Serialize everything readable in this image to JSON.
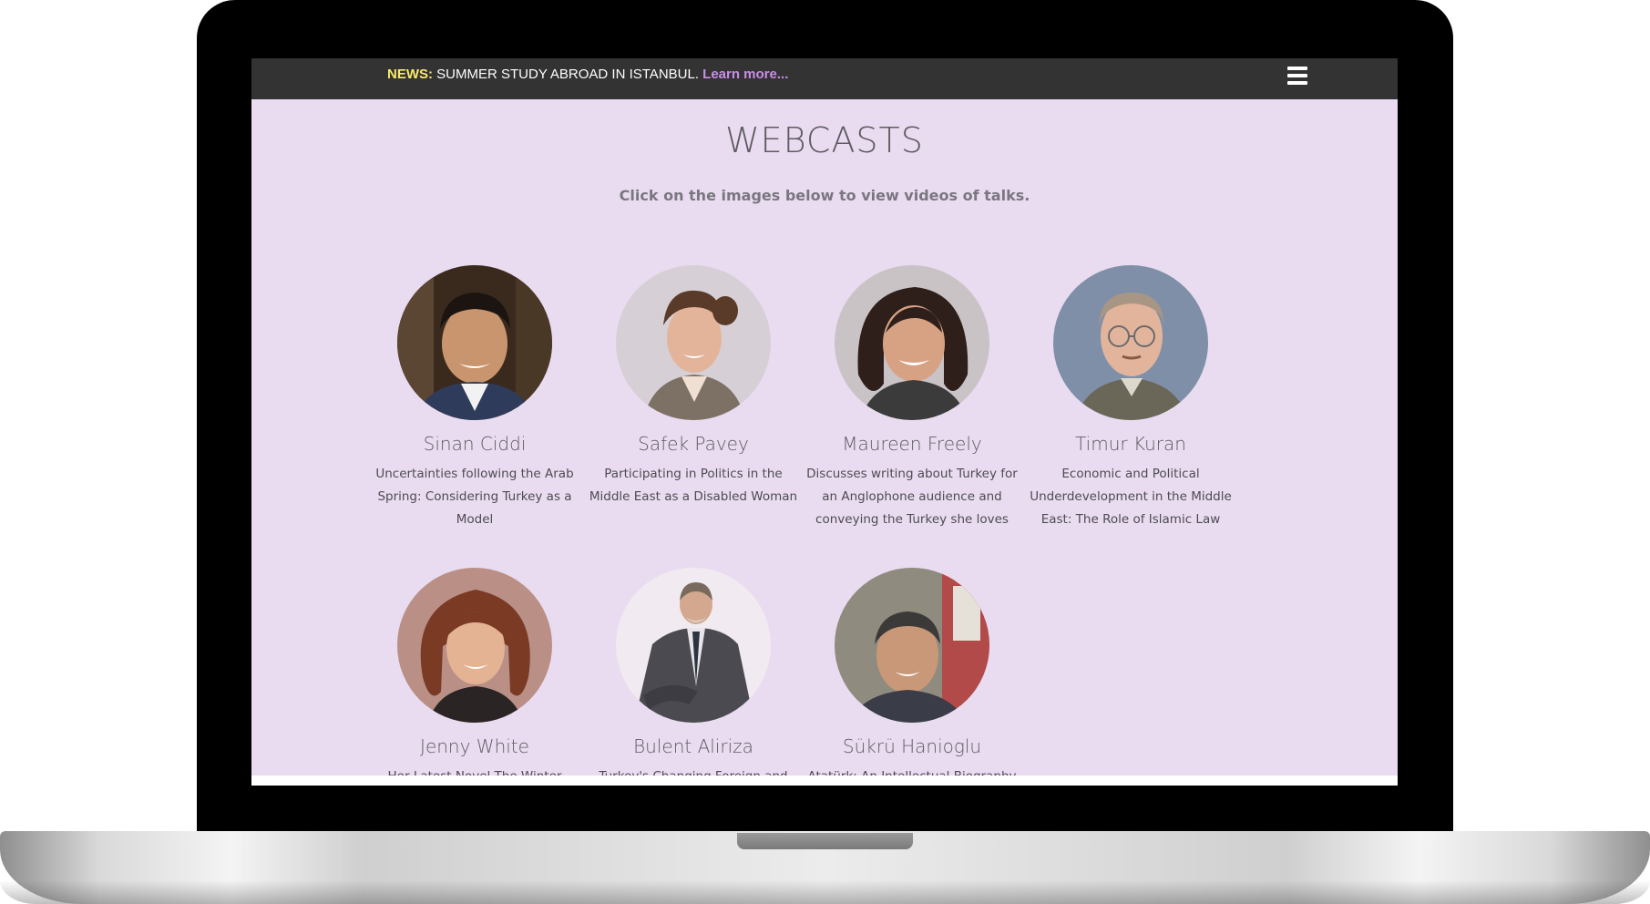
{
  "news_bar": {
    "label": "NEWS:",
    "text": " SUMMER STUDY ABROAD IN ISTANBUL. ",
    "link": "Learn more...",
    "menu_icon": "hamburger-menu-icon"
  },
  "page": {
    "title": "WEBCASTS",
    "subtitle": "Click on the images below to view videos of talks."
  },
  "speakers": [
    {
      "name": "Sinan Ciddi",
      "description": "Uncertainties following the Arab Spring: Considering Turkey as a Model",
      "photo": "speaker-photo"
    },
    {
      "name": "Safek Pavey",
      "description": "Participating in Politics in the Middle East as a Disabled Woman",
      "photo": "speaker-photo"
    },
    {
      "name": "Maureen Freely",
      "description": "Discusses writing about Turkey for an Anglophone audience and conveying the Turkey she loves",
      "photo": "speaker-photo"
    },
    {
      "name": "Timur Kuran",
      "description": "Economic and Political Underdevelopment in the Middle East: The Role of Islamic Law",
      "photo": "speaker-photo"
    },
    {
      "name": "Jenny White",
      "description": "Her Latest Novel The Winter",
      "photo": "speaker-photo"
    },
    {
      "name": "Bulent Aliriza",
      "description": "Turkey's Changing Foreign and",
      "photo": "speaker-photo"
    },
    {
      "name": "Sükrü Hanioglu",
      "description": "Atatürk: An Intellectual Biography",
      "photo": "speaker-photo"
    }
  ],
  "back_to_top": {
    "icon": "chevron-up-icon"
  },
  "colors": {
    "news_bar_bg": "#333333",
    "news_label": "#f7e96b",
    "news_link": "#c78ee6",
    "content_bg": "#e9dcf0",
    "back_to_top_bg": "#a596aa"
  }
}
